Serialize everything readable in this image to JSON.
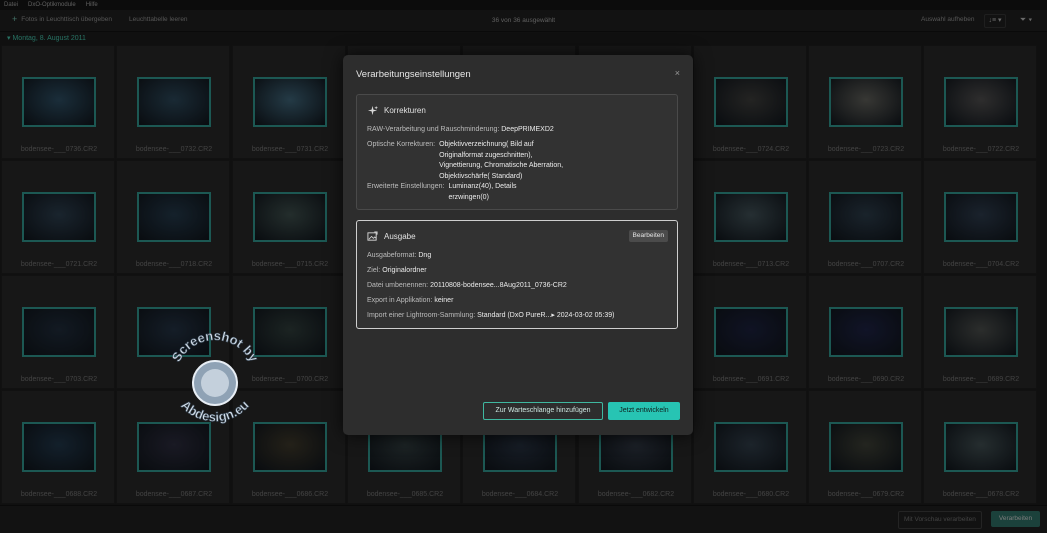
{
  "menubar": {
    "items": [
      "Datei",
      "DxO-Optikmodule",
      "Hilfe"
    ]
  },
  "toolbar": {
    "add_label": "Fotos in Leuchttisch übergeben",
    "clear_label": "Leuchttabelle leeren",
    "selection_count": "36 von 36 ausgewählt",
    "deselect_label": "Auswahl aufheben",
    "sort_icon": "sort-icon",
    "filter_icon": "filter-icon"
  },
  "group_date": "Montag, 8. August 2011",
  "thumbnails": [
    {
      "name": "bodensee-___0736.CR2",
      "tone": "#2b4a5e"
    },
    {
      "name": "bodensee-___0732.CR2",
      "tone": "#2a4455"
    },
    {
      "name": "bodensee-___0731.CR2",
      "tone": "#3b5f72"
    },
    {
      "name": "",
      "tone": "#252a33"
    },
    {
      "name": "",
      "tone": "#252a33"
    },
    {
      "name": "",
      "tone": "#252a33"
    },
    {
      "name": "bodensee-___0724.CR2",
      "tone": "#3a3a38"
    },
    {
      "name": "bodensee-___0723.CR2",
      "tone": "#5a5a55"
    },
    {
      "name": "bodensee-___0722.CR2",
      "tone": "#4b4a4a"
    },
    {
      "name": "bodensee-___0721.CR2",
      "tone": "#2a3b4a"
    },
    {
      "name": "bodensee-___0718.CR2",
      "tone": "#223646"
    },
    {
      "name": "bodensee-___0715.CR2",
      "tone": "#3a4a48"
    },
    {
      "name": "",
      "tone": "#252a33"
    },
    {
      "name": "",
      "tone": "#252a33"
    },
    {
      "name": "",
      "tone": "#252a33"
    },
    {
      "name": "bodensee-___0713.CR2",
      "tone": "#3d4c52"
    },
    {
      "name": "bodensee-___0707.CR2",
      "tone": "#2a3946"
    },
    {
      "name": "bodensee-___0704.CR2",
      "tone": "#2b3848"
    },
    {
      "name": "bodensee-___0703.CR2",
      "tone": "#1e2a38"
    },
    {
      "name": "",
      "tone": "#223040"
    },
    {
      "name": "bodensee-___0700.CR2",
      "tone": "#2d3a38"
    },
    {
      "name": "",
      "tone": "#252a33"
    },
    {
      "name": "",
      "tone": "#252a33"
    },
    {
      "name": "",
      "tone": "#252a33"
    },
    {
      "name": "bodensee-___0691.CR2",
      "tone": "#1a1f3a"
    },
    {
      "name": "bodensee-___0690.CR2",
      "tone": "#1c2140"
    },
    {
      "name": "bodensee-___0689.CR2",
      "tone": "#474a48"
    },
    {
      "name": "bodensee-___0688.CR2",
      "tone": "#1f3446"
    },
    {
      "name": "bodensee-___0687.CR2",
      "tone": "#2a2a3a"
    },
    {
      "name": "bodensee-___0686.CR2",
      "tone": "#3a3528"
    },
    {
      "name": "bodensee-___0685.CR2",
      "tone": "#2f3a3c"
    },
    {
      "name": "bodensee-___0684.CR2",
      "tone": "#26303e"
    },
    {
      "name": "bodensee-___0682.CR2",
      "tone": "#2e3540"
    },
    {
      "name": "bodensee-___0680.CR2",
      "tone": "#2e3a45"
    },
    {
      "name": "bodensee-___0679.CR2",
      "tone": "#3a3c33"
    },
    {
      "name": "bodensee-___0678.CR2",
      "tone": "#3d4a4d"
    }
  ],
  "dialog": {
    "title": "Verarbeitungseinstellungen",
    "close_icon": "close-icon",
    "corrections": {
      "heading": "Korrekturen",
      "raw_label": "RAW-Verarbeitung und Rauschminderung:",
      "raw_value": "DeepPRIMEXD2",
      "optical_label": "Optische Korrekturen:",
      "optical_value": [
        "Objektivverzeichnung( Bild auf",
        "Originalformat zugeschnitten),",
        "Vignettierung, Chromatische Aberration,",
        "Objektivschärfe( Standard)"
      ],
      "advanced_label": "Erweiterte Einstellungen:",
      "advanced_value": [
        "Luminanz(40), Details",
        "erzwingen(0)"
      ]
    },
    "output": {
      "heading": "Ausgabe",
      "edit_label": "Bearbeiten",
      "format_label": "Ausgabeformat:",
      "format_value": "Dng",
      "target_label": "Ziel:",
      "target_value": "Originalordner",
      "rename_label": "Datei umbenennen:",
      "rename_value": "20110808-bodensee...8Aug2011_0736-CR2",
      "export_label": "Export in Applikation:",
      "export_value": "keiner",
      "lightroom_label": "Import einer Lightroom-Sammlung:",
      "lightroom_value": "Standard (DxO PureR...▸ 2024-03-02 05:39)"
    },
    "queue_label": "Zur Warteschlange hinzufügen",
    "process_now_label": "Jetzt entwickeln"
  },
  "bottombar": {
    "preview_label": "Mit Vorschau verarbeiten",
    "process_label": "Verarbeiten"
  },
  "colors": {
    "accent": "#27c4b3",
    "thumb_border": "#2e8f86",
    "dialog_bg": "#2d2d2d"
  },
  "watermark": {
    "line1": "Screenshot by",
    "line2": "Abdesign.eu"
  }
}
